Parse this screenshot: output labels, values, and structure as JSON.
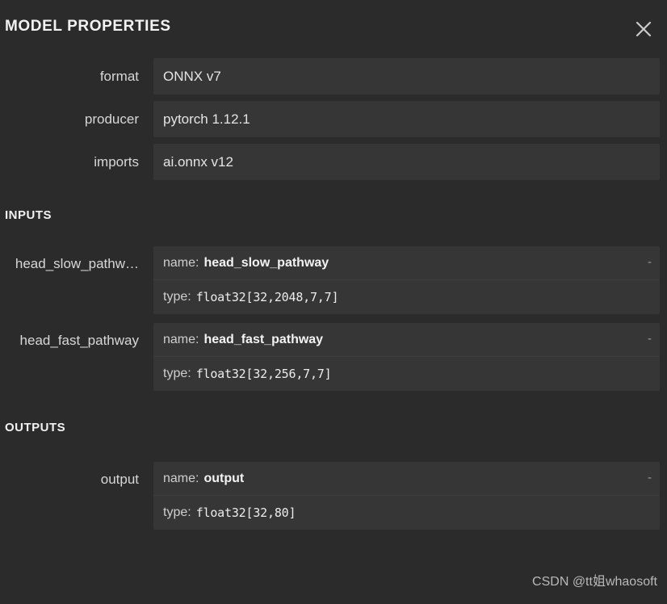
{
  "header": {
    "title": "MODEL PROPERTIES",
    "close_icon": "close-icon"
  },
  "properties": [
    {
      "label": "format",
      "value": "ONNX v7"
    },
    {
      "label": "producer",
      "value": "pytorch 1.12.1"
    },
    {
      "label": "imports",
      "value": "ai.onnx v12"
    }
  ],
  "inputs": {
    "heading": "INPUTS",
    "items": [
      {
        "label": "head_slow_pathw…",
        "name_key": "name:",
        "name_value": "head_slow_pathway",
        "type_key": "type:",
        "type_value": "float32[32,2048,7,7]",
        "marker": "-"
      },
      {
        "label": "head_fast_pathway",
        "name_key": "name:",
        "name_value": "head_fast_pathway",
        "type_key": "type:",
        "type_value": "float32[32,256,7,7]",
        "marker": "-"
      }
    ]
  },
  "outputs": {
    "heading": "OUTPUTS",
    "items": [
      {
        "label": "output",
        "name_key": "name:",
        "name_value": "output",
        "type_key": "type:",
        "type_value": "float32[32,80]",
        "marker": "-"
      }
    ]
  },
  "watermark": {
    "text": "CSDN @tt姐whaosoft"
  },
  "colors": {
    "background": "#2b2b2b",
    "value_box": "#363636",
    "text_primary": "#f2f2f2",
    "text_secondary": "#d7d7d7"
  }
}
